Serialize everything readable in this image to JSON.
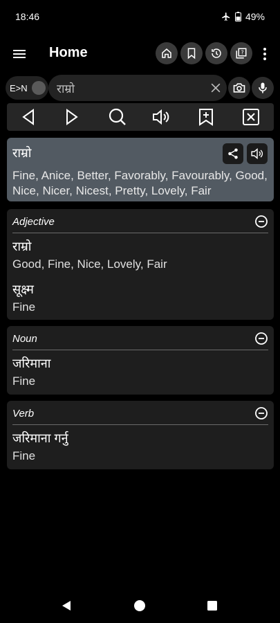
{
  "status": {
    "time": "18:46",
    "battery": "49%"
  },
  "app_bar": {
    "title": "Home"
  },
  "search": {
    "lang_toggle": "E>N",
    "query": "राम्रो"
  },
  "result": {
    "word": "राम्रो",
    "meaning": "Fine, Anice, Better, Favorably, Favourably, Good, Nice, Nicer, Nicest, Pretty, Lovely, Fair"
  },
  "sections": {
    "adjective": {
      "label": "Adjective",
      "entries": [
        {
          "word": "राम्रो",
          "meaning": "Good, Fine, Nice, Lovely, Fair"
        },
        {
          "word": "सूक्ष्म",
          "meaning": "Fine"
        }
      ]
    },
    "noun": {
      "label": "Noun",
      "entries": [
        {
          "word": "जरिमाना",
          "meaning": "Fine"
        }
      ]
    },
    "verb": {
      "label": "Verb",
      "entries": [
        {
          "word": "जरिमाना गर्नु",
          "meaning": "Fine"
        }
      ]
    }
  },
  "colors": {
    "background": "#000000",
    "result_card": "#525a62",
    "section_card": "#1e1e1e",
    "toolbar": "#262626"
  }
}
